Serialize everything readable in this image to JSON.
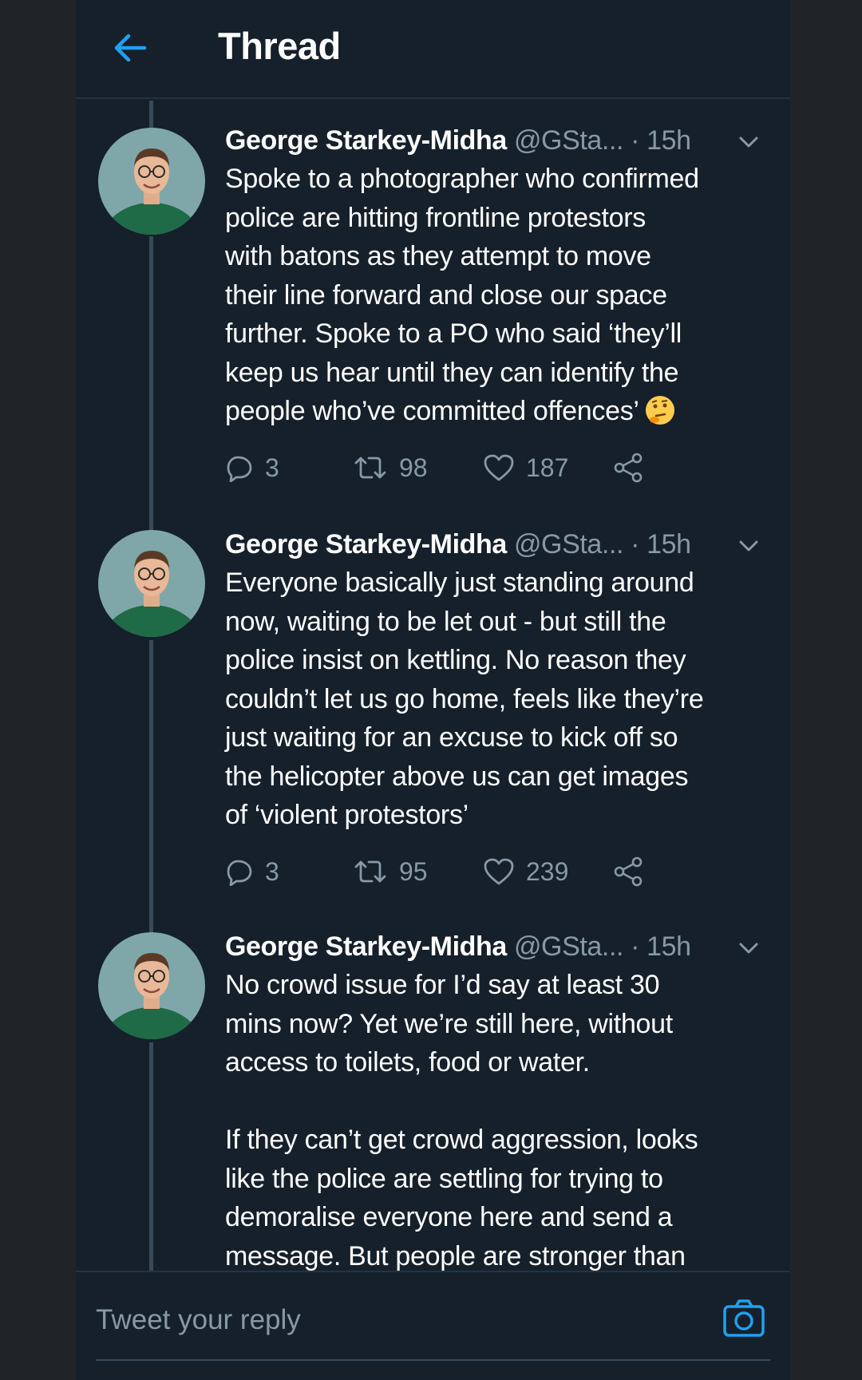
{
  "header": {
    "title": "Thread"
  },
  "tweets": [
    {
      "author_name": "George Starkey-Midha",
      "handle": "@GSta...",
      "separator": "·",
      "time": "15h",
      "text": "Spoke to a photographer who confirmed\npolice are hitting frontline protestors\nwith batons as they attempt to move\ntheir line forward and close our space\nfurther. Spoke to a PO who said ‘they’ll\nkeep us hear until they can identify the\npeople who’ve committed offences’",
      "emoji": "thinking-face-icon",
      "replies": "3",
      "retweets": "98",
      "likes": "187"
    },
    {
      "author_name": "George Starkey-Midha",
      "handle": "@GSta...",
      "separator": "·",
      "time": "15h",
      "text": "Everyone basically just standing around\nnow, waiting to be let out - but still the\npolice insist on kettling. No reason they\ncouldn’t let us go home, feels like they’re\njust waiting for an excuse to kick off so\nthe helicopter above us can get images\nof ‘violent protestors’",
      "replies": "3",
      "retweets": "95",
      "likes": "239"
    },
    {
      "author_name": "George Starkey-Midha",
      "handle": "@GSta...",
      "separator": "·",
      "time": "15h",
      "text": "No crowd issue for I’d say at least 30\nmins now? Yet we’re still here, without\naccess to toilets, food or water.\n\nIf they can’t get crowd aggression, looks\nlike the police are settling for trying to\ndemoralise everyone here and send a\nmessage. But people are stronger than"
    }
  ],
  "reply_bar": {
    "placeholder": "Tweet your reply"
  },
  "colors": {
    "background": "#15202b",
    "accent": "#1da1f2",
    "muted": "#8899a6",
    "divider": "#243340"
  }
}
